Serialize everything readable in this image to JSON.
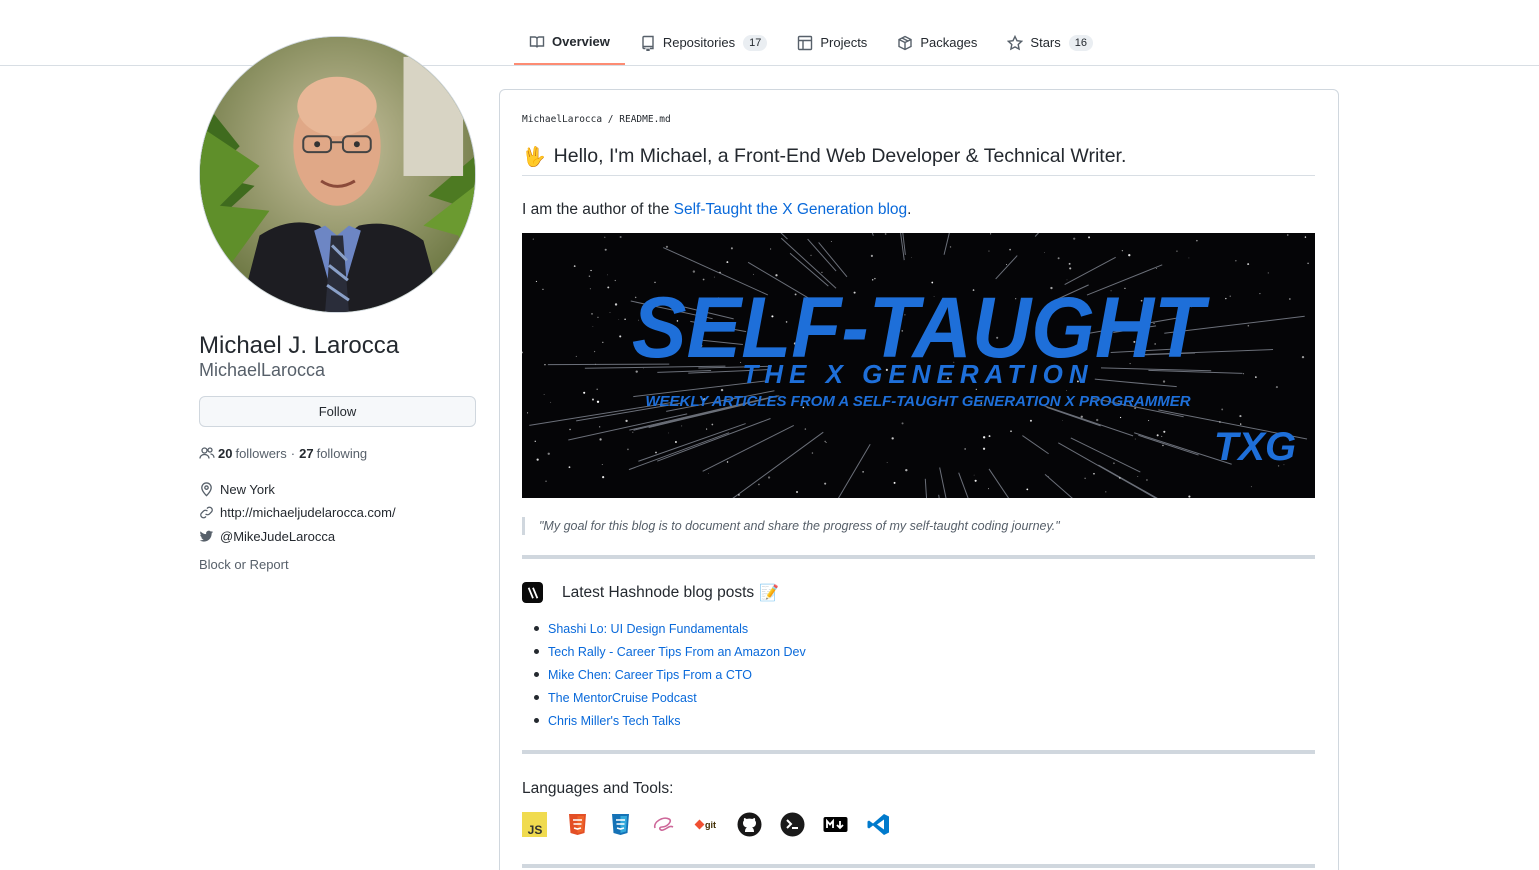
{
  "nav": {
    "tabs": [
      {
        "label": "Overview",
        "icon": "book-icon",
        "active": true
      },
      {
        "label": "Repositories",
        "icon": "repo-icon",
        "count": "17"
      },
      {
        "label": "Projects",
        "icon": "project-icon"
      },
      {
        "label": "Packages",
        "icon": "package-icon"
      },
      {
        "label": "Stars",
        "icon": "star-icon",
        "count": "16"
      }
    ]
  },
  "profile": {
    "full_name": "Michael J. Larocca",
    "username": "MichaelLarocca",
    "follow_label": "Follow",
    "followers_count": "20",
    "followers_label": "followers",
    "separator": "·",
    "following_count": "27",
    "following_label": "following",
    "location": "New York",
    "website": "http://michaeljudelarocca.com/",
    "twitter": "@MikeJudeLarocca",
    "block_report": "Block or Report"
  },
  "readme": {
    "path_owner": "MichaelLarocca",
    "path_sep": " / ",
    "path_file": "README.md",
    "heading": "Hello, I'm Michael, a Front-End Web Developer & Technical Writer.",
    "intro_prefix": "I am the author of the ",
    "intro_link": "Self-Taught the X Generation blog",
    "intro_suffix": ".",
    "banner": {
      "title": "SELF-TAUGHT",
      "subtitle": "THE X GENERATION",
      "tagline": "WEEKLY ARTICLES FROM A SELF-TAUGHT GENERATION X PROGRAMMER",
      "logo": "TXG"
    },
    "quote": "\"My goal for this blog is to document and share the progress of my self-taught coding journey.\"",
    "posts_heading": "Latest Hashnode blog posts",
    "posts": [
      "Shashi Lo: UI Design Fundamentals",
      "Tech Rally - Career Tips From an Amazon Dev",
      "Mike Chen: Career Tips From a CTO",
      "The MentorCruise Podcast",
      "Chris Miller's Tech Talks"
    ],
    "languages_heading": "Languages and Tools:",
    "tools": [
      "javascript-icon",
      "html5-icon",
      "css3-icon",
      "sass-icon",
      "git-icon",
      "github-icon",
      "terminal-icon",
      "markdown-icon",
      "vscode-icon"
    ]
  },
  "colors": {
    "accent_tab": "#fd8c73",
    "link": "#0969da",
    "banner_blue": "#1e6fd9"
  }
}
